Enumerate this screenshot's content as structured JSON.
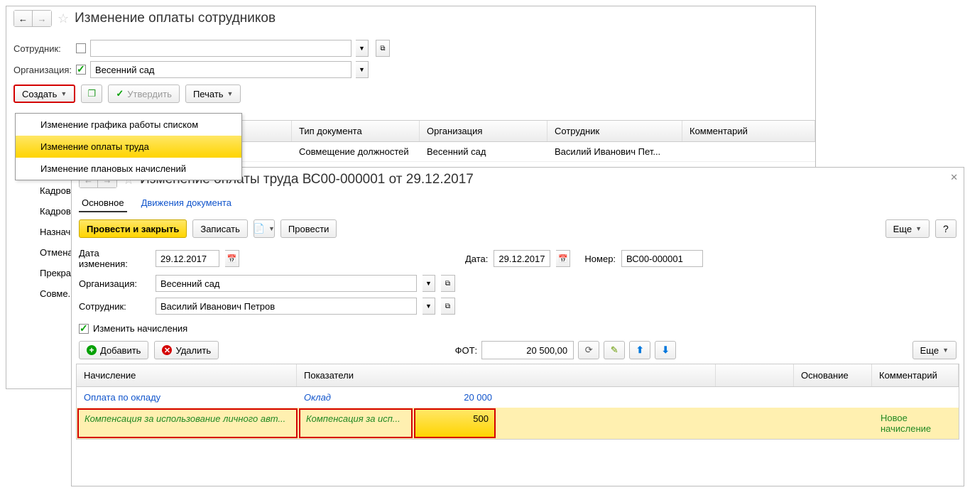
{
  "main": {
    "title": "Изменение оплаты сотрудников",
    "labels": {
      "employee": "Сотрудник:",
      "org": "Организация:"
    },
    "org_value": "Весенний сад",
    "toolbar": {
      "create": "Создать",
      "approve": "Утвердить",
      "print": "Печать"
    },
    "menu": {
      "items": [
        "Изменение графика работы списком",
        "Изменение оплаты труда",
        "Изменение плановых начислений"
      ],
      "truncated": [
        "Кадров...",
        "Кадров...",
        "Назнач...",
        "Отмена...",
        "Прекра...",
        "Совме..."
      ]
    },
    "grid": {
      "headers": {
        "doctype": "Тип документа",
        "org": "Организация",
        "emp": "Сотрудник",
        "comment": "Комментарий"
      },
      "row": {
        "doctype": "Совмещение должностей",
        "org": "Весенний сад",
        "emp": "Василий Иванович Пет..."
      }
    }
  },
  "sub": {
    "title": "Изменение оплаты труда ВС00-000001 от 29.12.2017",
    "tabs": {
      "main": "Основное",
      "moves": "Движения документа"
    },
    "toolbar": {
      "post_close": "Провести и закрыть",
      "write": "Записать",
      "post": "Провести",
      "more": "Еще",
      "help": "?"
    },
    "fields": {
      "change_date_label": "Дата изменения:",
      "change_date": "29.12.2017",
      "date_label": "Дата:",
      "date": "29.12.2017",
      "number_label": "Номер:",
      "number": "ВС00-000001",
      "org_label": "Организация:",
      "org": "Весенний сад",
      "emp_label": "Сотрудник:",
      "emp": "Василий Иванович Петров",
      "change_calc": "Изменить начисления"
    },
    "actions": {
      "add": "Добавить",
      "delete": "Удалить",
      "fot_label": "ФОТ:",
      "fot": "20 500,00",
      "more2": "Еще"
    },
    "table": {
      "headers": {
        "calc": "Начисление",
        "ind": "Показатели",
        "base": "Основание",
        "comment": "Комментарий"
      },
      "rows": [
        {
          "calc": "Оплата по окладу",
          "ind_name": "Оклад",
          "ind_val": "20 000",
          "comment": ""
        },
        {
          "calc": "Компенсация за использование личного авт...",
          "ind_name": "Компенсация за исп...",
          "ind_val": "500",
          "comment": "Новое начисление"
        }
      ]
    }
  }
}
